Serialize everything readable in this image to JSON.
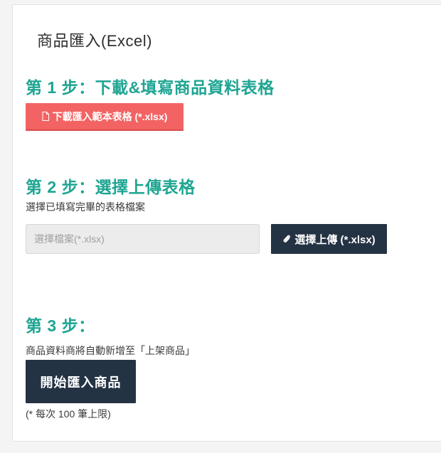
{
  "page": {
    "title": "商品匯入(Excel)"
  },
  "step1": {
    "heading": "第 1 步：下載&填寫商品資料表格",
    "download_button_label": "下載匯入範本表格 (*.xlsx)",
    "download_icon": "file-icon",
    "download_button_color": "#f36363"
  },
  "step2": {
    "heading": "第 2 步：選擇上傳表格",
    "description": "選擇已填寫完畢的表格檔案",
    "file_input_placeholder": "選擇檔案(*.xlsx)",
    "file_input_value": "",
    "upload_button_label": "選擇上傳 (*.xlsx)",
    "upload_icon": "paperclip-icon"
  },
  "step3": {
    "heading": "第 3 步：",
    "description": "商品資料商將自動新增至「上架商品」",
    "start_button_label": "開始匯入商品",
    "limit_note": "(* 每次 100 筆上限)"
  },
  "colors": {
    "accent_teal": "#1ea592",
    "dark_button": "#243344",
    "danger_button": "#f36363"
  }
}
